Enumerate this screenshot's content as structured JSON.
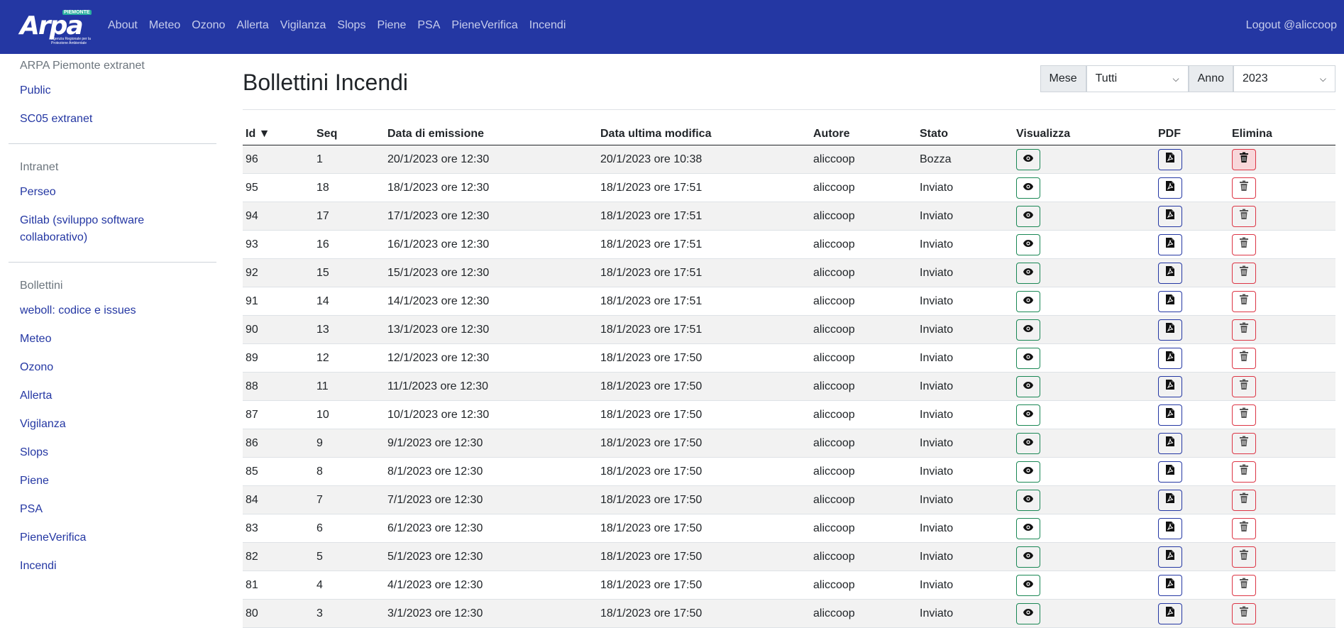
{
  "navbar": {
    "logo_text": "Arpa",
    "logo_badge": "PIEMONTE",
    "logo_subtitle": "Agenzia Regionale per la Protezione Ambientale",
    "links": [
      "About",
      "Meteo",
      "Ozono",
      "Allerta",
      "Vigilanza",
      "Slops",
      "Piene",
      "PSA",
      "PieneVerifica",
      "Incendi"
    ],
    "logout": "Logout @aliccoop"
  },
  "sidebar": {
    "sections": [
      {
        "title": "ARPA Piemonte extranet",
        "links": [
          "Public",
          "SC05 extranet"
        ]
      },
      {
        "title": "Intranet",
        "links": [
          "Perseo",
          "Gitlab (sviluppo software collaborativo)"
        ]
      },
      {
        "title": "Bollettini",
        "links": [
          "weboll: codice e issues",
          "Meteo",
          "Ozono",
          "Allerta",
          "Vigilanza",
          "Slops",
          "Piene",
          "PSA",
          "PieneVerifica",
          "Incendi"
        ]
      }
    ]
  },
  "main": {
    "title": "Bollettini Incendi",
    "filters": {
      "mese_label": "Mese",
      "mese_value": "Tutti",
      "anno_label": "Anno",
      "anno_value": "2023"
    },
    "table": {
      "headers": [
        "Id ▼",
        "Seq",
        "Data di emissione",
        "Data ultima modifica",
        "Autore",
        "Stato",
        "Visualizza",
        "PDF",
        "Elimina"
      ],
      "rows": [
        [
          "96",
          "1",
          "20/1/2023 ore 12:30",
          "20/1/2023 ore 10:38",
          "aliccoop",
          "Bozza"
        ],
        [
          "95",
          "18",
          "18/1/2023 ore 12:30",
          "18/1/2023 ore 17:51",
          "aliccoop",
          "Inviato"
        ],
        [
          "94",
          "17",
          "17/1/2023 ore 12:30",
          "18/1/2023 ore 17:51",
          "aliccoop",
          "Inviato"
        ],
        [
          "93",
          "16",
          "16/1/2023 ore 12:30",
          "18/1/2023 ore 17:51",
          "aliccoop",
          "Inviato"
        ],
        [
          "92",
          "15",
          "15/1/2023 ore 12:30",
          "18/1/2023 ore 17:51",
          "aliccoop",
          "Inviato"
        ],
        [
          "91",
          "14",
          "14/1/2023 ore 12:30",
          "18/1/2023 ore 17:51",
          "aliccoop",
          "Inviato"
        ],
        [
          "90",
          "13",
          "13/1/2023 ore 12:30",
          "18/1/2023 ore 17:51",
          "aliccoop",
          "Inviato"
        ],
        [
          "89",
          "12",
          "12/1/2023 ore 12:30",
          "18/1/2023 ore 17:50",
          "aliccoop",
          "Inviato"
        ],
        [
          "88",
          "11",
          "11/1/2023 ore 12:30",
          "18/1/2023 ore 17:50",
          "aliccoop",
          "Inviato"
        ],
        [
          "87",
          "10",
          "10/1/2023 ore 12:30",
          "18/1/2023 ore 17:50",
          "aliccoop",
          "Inviato"
        ],
        [
          "86",
          "9",
          "9/1/2023 ore 12:30",
          "18/1/2023 ore 17:50",
          "aliccoop",
          "Inviato"
        ],
        [
          "85",
          "8",
          "8/1/2023 ore 12:30",
          "18/1/2023 ore 17:50",
          "aliccoop",
          "Inviato"
        ],
        [
          "84",
          "7",
          "7/1/2023 ore 12:30",
          "18/1/2023 ore 17:50",
          "aliccoop",
          "Inviato"
        ],
        [
          "83",
          "6",
          "6/1/2023 ore 12:30",
          "18/1/2023 ore 17:50",
          "aliccoop",
          "Inviato"
        ],
        [
          "82",
          "5",
          "5/1/2023 ore 12:30",
          "18/1/2023 ore 17:50",
          "aliccoop",
          "Inviato"
        ],
        [
          "81",
          "4",
          "4/1/2023 ore 12:30",
          "18/1/2023 ore 17:50",
          "aliccoop",
          "Inviato"
        ],
        [
          "80",
          "3",
          "3/1/2023 ore 12:30",
          "18/1/2023 ore 17:50",
          "aliccoop",
          "Inviato"
        ]
      ]
    }
  },
  "colors": {
    "navbar": "#2437a3",
    "link": "#2437a3",
    "view": "#198754",
    "delete": "#dc3545"
  },
  "icons": {
    "view": "eye-icon",
    "pdf": "pdf-file-icon",
    "delete": "trash-icon"
  }
}
